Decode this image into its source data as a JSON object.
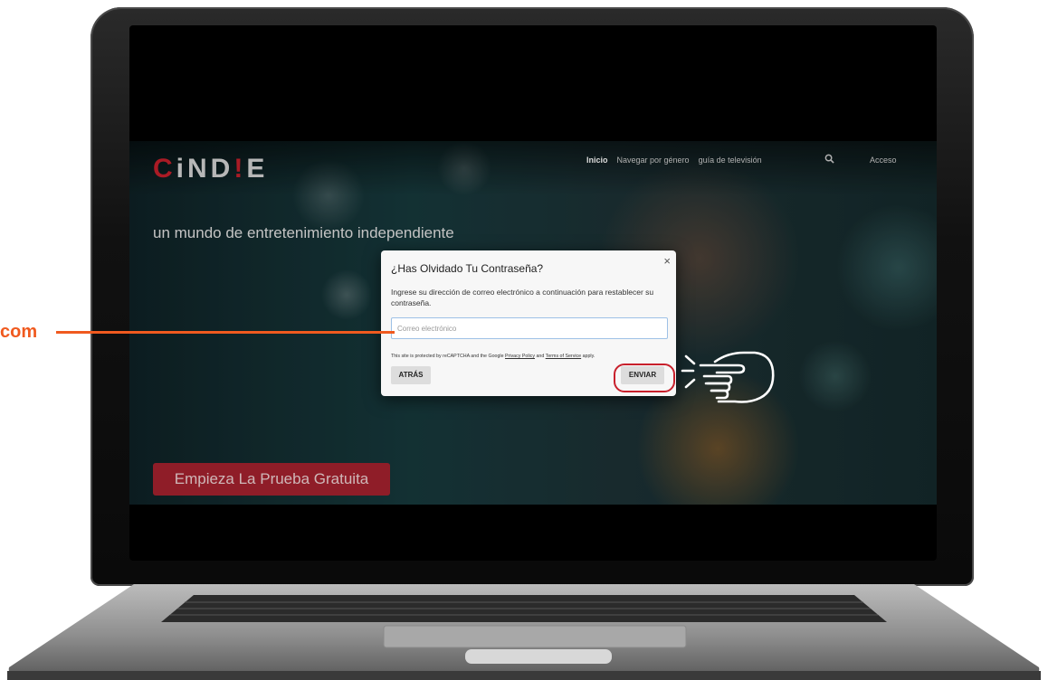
{
  "site": {
    "logo": {
      "pre": "C",
      "mid1": "iND",
      "accent": "!",
      "post": "E"
    },
    "nav": {
      "items": [
        {
          "label": "Inicio",
          "active": true
        },
        {
          "label": "Navegar por género",
          "active": false
        },
        {
          "label": "guía de televisión",
          "active": false
        }
      ],
      "search_icon": "search-icon",
      "login_label": "Acceso"
    },
    "tagline": "un mundo de entretenimiento independiente",
    "cta_label": "Empieza La Prueba Gratuita"
  },
  "modal": {
    "close_symbol": "×",
    "title": "¿Has Olvidado Tu Contraseña?",
    "description": "Ingrese su dirección de correo electrónico a continuación para restablecer su contraseña.",
    "email_placeholder": "Correo electrónico",
    "email_value": "",
    "recaptcha": {
      "prefix": "This site is protected by reCAPTCHA and the Google ",
      "privacy": "Privacy Policy",
      "and": " and ",
      "terms": "Terms of Service",
      "suffix": " apply."
    },
    "back_label": "ATRÁS",
    "send_label": "ENVIAR"
  },
  "annotation": {
    "text": "com",
    "color": "#f05a1f",
    "highlight_color": "#c8202c"
  },
  "colors": {
    "brand_red": "#c8202c",
    "cta_red": "#a8232f"
  }
}
